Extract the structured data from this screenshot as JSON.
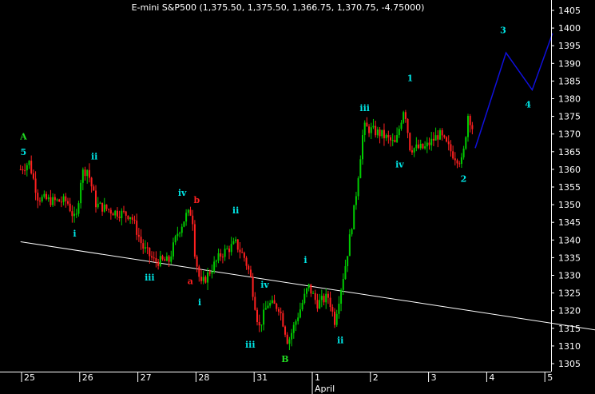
{
  "chart_data": {
    "type": "candlestick",
    "title": "E-mini S&P500 (1,375.50, 1,375.50, 1,366.75, 1,370.75, -4.75000)",
    "ylim": [
      1302,
      1410
    ],
    "y_ticks": [
      1305,
      1310,
      1315,
      1320,
      1325,
      1330,
      1335,
      1340,
      1345,
      1350,
      1355,
      1360,
      1365,
      1370,
      1375,
      1380,
      1385,
      1390,
      1395,
      1400,
      1405
    ],
    "x_range": [
      -0.1,
      10.3
    ],
    "day_ticks": [
      {
        "label": "25",
        "x": 0
      },
      {
        "label": "26",
        "x": 1
      },
      {
        "label": "27",
        "x": 2
      },
      {
        "label": "28",
        "x": 3
      },
      {
        "label": "31",
        "x": 4
      },
      {
        "label": "1",
        "x": 5
      },
      {
        "label": "2",
        "x": 6
      },
      {
        "label": "3",
        "x": 7
      },
      {
        "label": "4",
        "x": 8
      },
      {
        "label": "5",
        "x": 9
      }
    ],
    "month_label": {
      "label": "April",
      "x": 5
    },
    "colors": {
      "up": "#00cc00",
      "down": "#ff2020",
      "trendline": "#ffffff",
      "projection": "#1010dd",
      "axis": "#ffffff",
      "wave_cyan": "#00e5e5",
      "wave_green": "#22dd22",
      "wave_red": "#ff2020"
    },
    "price_path": [
      [
        -0.1,
        1360
      ],
      [
        0.05,
        1362
      ],
      [
        0.2,
        1352
      ],
      [
        0.45,
        1351
      ],
      [
        0.7,
        1351
      ],
      [
        0.85,
        1345
      ],
      [
        0.95,
        1359
      ],
      [
        1.05,
        1360
      ],
      [
        1.2,
        1350
      ],
      [
        1.5,
        1348
      ],
      [
        1.8,
        1347
      ],
      [
        2.0,
        1338
      ],
      [
        2.2,
        1334
      ],
      [
        2.45,
        1334
      ],
      [
        2.6,
        1342
      ],
      [
        2.75,
        1347
      ],
      [
        2.85,
        1348
      ],
      [
        2.9,
        1336
      ],
      [
        3.0,
        1327
      ],
      [
        3.15,
        1331
      ],
      [
        3.35,
        1336
      ],
      [
        3.6,
        1339
      ],
      [
        3.75,
        1335
      ],
      [
        3.85,
        1330
      ],
      [
        4.0,
        1315
      ],
      [
        4.15,
        1322
      ],
      [
        4.35,
        1321
      ],
      [
        4.5,
        1311
      ],
      [
        4.7,
        1320
      ],
      [
        4.85,
        1327
      ],
      [
        5.0,
        1322
      ],
      [
        5.2,
        1324
      ],
      [
        5.3,
        1317
      ],
      [
        5.5,
        1334
      ],
      [
        5.65,
        1350
      ],
      [
        5.8,
        1372
      ],
      [
        6.1,
        1370
      ],
      [
        6.35,
        1367
      ],
      [
        6.5,
        1378
      ],
      [
        6.6,
        1366
      ],
      [
        6.85,
        1366
      ],
      [
        7.1,
        1370
      ],
      [
        7.35,
        1364
      ],
      [
        7.5,
        1362
      ],
      [
        7.6,
        1376
      ],
      [
        7.7,
        1370
      ]
    ],
    "price_path_scale": 1.0,
    "trendline": [
      [
        -0.1,
        1339.5
      ],
      [
        10.2,
        1313.5
      ]
    ],
    "projection": [
      [
        7.72,
        1366
      ],
      [
        8.25,
        1393
      ],
      [
        8.7,
        1382.5
      ],
      [
        9.05,
        1398.5
      ]
    ],
    "wave_labels": [
      {
        "text": "A",
        "x": -0.05,
        "y": 1368.5,
        "color": "wave_green"
      },
      {
        "text": "5",
        "x": -0.05,
        "y": 1364,
        "color": "wave_cyan"
      },
      {
        "text": "ii",
        "x": 1.17,
        "y": 1362.8,
        "color": "wave_cyan"
      },
      {
        "text": "i",
        "x": 0.83,
        "y": 1341,
        "color": "wave_cyan"
      },
      {
        "text": "iii",
        "x": 2.12,
        "y": 1328.5,
        "color": "wave_cyan"
      },
      {
        "text": "iv",
        "x": 2.68,
        "y": 1352.5,
        "color": "wave_cyan"
      },
      {
        "text": "b",
        "x": 2.93,
        "y": 1350.5,
        "color": "wave_red"
      },
      {
        "text": "a",
        "x": 2.82,
        "y": 1327.5,
        "color": "wave_red"
      },
      {
        "text": "ii",
        "x": 3.6,
        "y": 1347.5,
        "color": "wave_cyan"
      },
      {
        "text": "i",
        "x": 2.98,
        "y": 1321.5,
        "color": "wave_cyan"
      },
      {
        "text": "iv",
        "x": 4.1,
        "y": 1326.5,
        "color": "wave_cyan"
      },
      {
        "text": "iii",
        "x": 3.85,
        "y": 1309.5,
        "color": "wave_cyan"
      },
      {
        "text": "B",
        "x": 4.45,
        "y": 1305.5,
        "color": "wave_green"
      },
      {
        "text": "i",
        "x": 4.8,
        "y": 1333.5,
        "color": "wave_cyan"
      },
      {
        "text": "ii",
        "x": 5.4,
        "y": 1310.8,
        "color": "wave_cyan"
      },
      {
        "text": "iii",
        "x": 5.82,
        "y": 1376.5,
        "color": "wave_cyan"
      },
      {
        "text": "iv",
        "x": 6.42,
        "y": 1360.5,
        "color": "wave_cyan"
      },
      {
        "text": "1",
        "x": 6.6,
        "y": 1385,
        "color": "wave_cyan"
      },
      {
        "text": "2",
        "x": 7.52,
        "y": 1356.5,
        "color": "wave_cyan"
      },
      {
        "text": "3",
        "x": 8.2,
        "y": 1398.5,
        "color": "wave_cyan"
      },
      {
        "text": "4",
        "x": 8.63,
        "y": 1377.5,
        "color": "wave_cyan"
      }
    ]
  }
}
